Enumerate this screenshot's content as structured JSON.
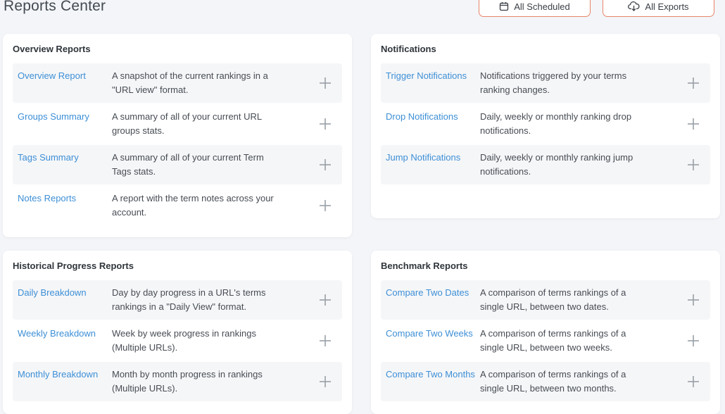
{
  "header": {
    "title": "Reports Center",
    "scheduled_label": "All Scheduled",
    "exports_label": "All Exports"
  },
  "cards": {
    "overview": {
      "title": "Overview Reports",
      "rows": [
        {
          "name": "Overview Report",
          "desc": "A snapshot of the current rankings in a \"URL view\" format."
        },
        {
          "name": "Groups Summary",
          "desc": "A summary of all of your current URL groups stats."
        },
        {
          "name": "Tags Summary",
          "desc": "A summary of all of your current Term Tags stats."
        },
        {
          "name": "Notes Reports",
          "desc": "A report with the term notes across your account."
        }
      ]
    },
    "notifications": {
      "title": "Notifications",
      "rows": [
        {
          "name": "Trigger Notifications",
          "desc": "Notifications triggered by your terms ranking changes."
        },
        {
          "name": "Drop Notifications",
          "desc": "Daily, weekly or monthly ranking drop notifications."
        },
        {
          "name": "Jump Notifications",
          "desc": "Daily, weekly or monthly ranking jump notifications."
        }
      ]
    },
    "historical": {
      "title": "Historical Progress Reports",
      "rows": [
        {
          "name": "Daily Breakdown",
          "desc": "Day by day progress in a URL's terms rankings in a \"Daily View\" format."
        },
        {
          "name": "Weekly Breakdown",
          "desc": "Week by week progress in rankings (Multiple URLs)."
        },
        {
          "name": "Monthly Breakdown",
          "desc": "Month by month progress in rankings (Multiple URLs)."
        }
      ]
    },
    "benchmark": {
      "title": "Benchmark Reports",
      "rows": [
        {
          "name": "Compare Two Dates",
          "desc": "A comparison of terms rankings of a single URL, between two dates."
        },
        {
          "name": "Compare Two Weeks",
          "desc": "A comparison of terms rankings of a single URL, between two weeks."
        },
        {
          "name": "Compare Two Months",
          "desc": "A comparison of terms rankings of a single URL, between two months."
        }
      ]
    }
  },
  "icons": {
    "scheduled": "calendar-icon",
    "exports": "cloud-download-icon",
    "add": "plus-icon"
  },
  "colors": {
    "accent_border": "#e9846a",
    "link": "#3d8fd6",
    "row_shade": "#f5f6f8",
    "background": "#f3f5f8"
  }
}
